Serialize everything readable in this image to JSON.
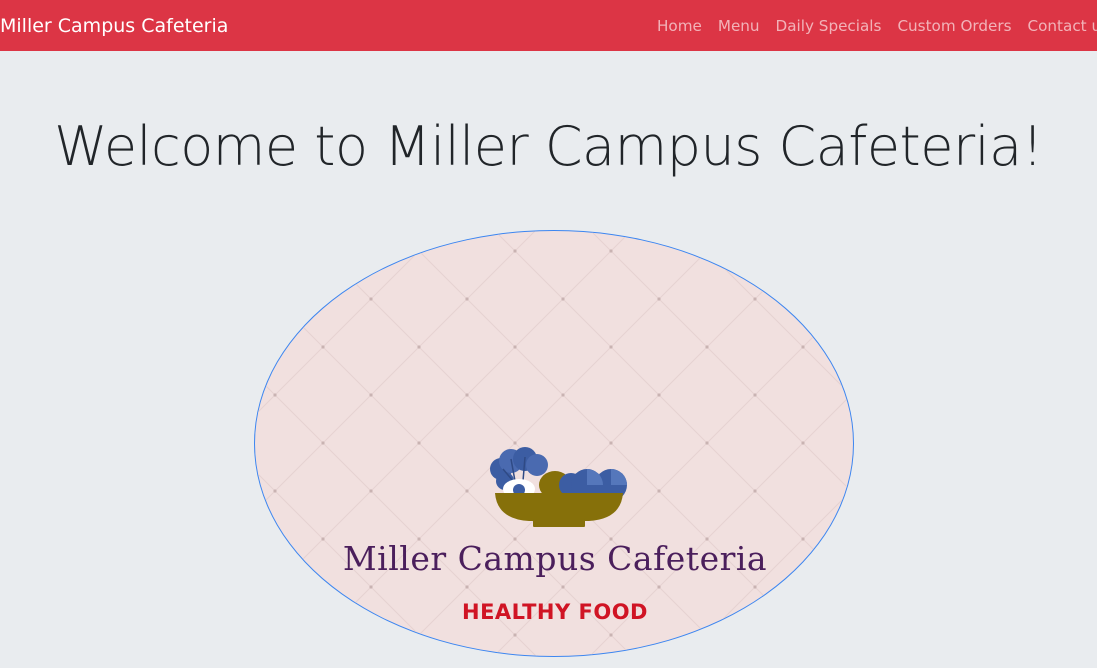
{
  "navbar": {
    "brand": "Miller Campus Cafeteria",
    "links": [
      "Home",
      "Menu",
      "Daily Specials",
      "Custom Orders",
      "Contact us"
    ]
  },
  "hero": {
    "title": "Welcome to Miller Campus Cafeteria!"
  },
  "logo": {
    "name": "Miller Campus Cafeteria",
    "tagline": "HEALTHY FOOD",
    "icon": "salad-bowl-icon"
  },
  "colors": {
    "navbar_bg": "#dc3545",
    "page_bg": "#e9ecef",
    "logo_bg": "#f1e0df",
    "logo_name": "#4b1f5c",
    "logo_tagline": "#d01424",
    "bowl": "#86700a",
    "vegetables": "#3c5da3"
  }
}
